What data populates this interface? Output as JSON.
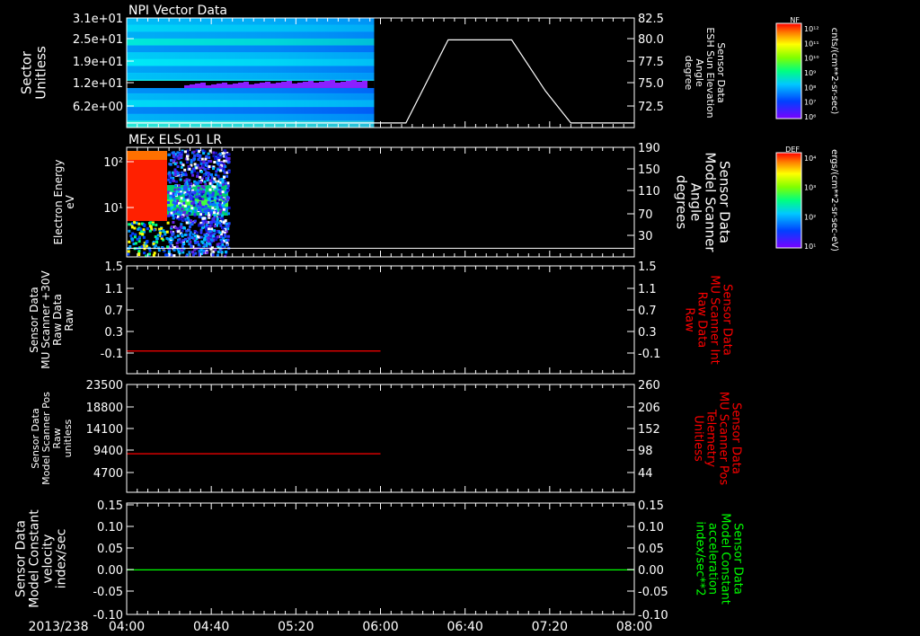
{
  "time_axis": {
    "date_label": "2013/238",
    "ticks": [
      "04:00",
      "04:40",
      "05:20",
      "06:00",
      "06:40",
      "07:20",
      "08:00"
    ]
  },
  "colors": {
    "white": "#ffffff",
    "red": "#ff0000",
    "green": "#00ff00",
    "background": "#000000"
  },
  "panels": [
    {
      "id": "npi",
      "title": "NPI Vector Data",
      "left_label": [
        "Sector",
        "Unitless"
      ],
      "left_ticks": [
        "3.1e+01",
        "2.5e+01",
        "1.9e+01",
        "1.2e+01",
        "6.2e+00"
      ],
      "right_label": [
        "Sensor Data",
        "ESH Sun Elevation",
        "Angle",
        "degree"
      ],
      "right_ticks": [
        "82.5",
        "80.0",
        "77.5",
        "75.0",
        "72.5"
      ],
      "colorbar": {
        "title": "NF",
        "ticks": [
          "10¹²",
          "10¹¹",
          "10¹⁰",
          "10⁹",
          "10⁸",
          "10⁷",
          "10⁶"
        ],
        "unit": "cnts/(cm**2-sr-sec)"
      }
    },
    {
      "id": "els",
      "title": "MEx ELS-01 LR",
      "left_label": [
        "Electron Energy",
        "eV"
      ],
      "left_ticks": [
        "10²",
        "10¹"
      ],
      "right_label": [
        "Sensor Data",
        "Model Scanner",
        "Angle",
        "degrees"
      ],
      "right_ticks": [
        "190",
        "150",
        "110",
        "70",
        "30"
      ],
      "colorbar": {
        "title": "DEF",
        "ticks": [
          "10⁴",
          "10³",
          "10²",
          "10¹"
        ],
        "unit": "ergs/(cm**2-sr-sec-eV)"
      }
    },
    {
      "id": "mu_int",
      "title": "",
      "left_label": [
        "Sensor Data",
        "MU Scanner +30V",
        "Raw Data",
        "Raw"
      ],
      "left_ticks": [
        "1.5",
        "1.1",
        "0.7",
        "0.3",
        "-0.1"
      ],
      "right_label": [
        "Sensor Data",
        "MU Scanner Int",
        "Raw Data",
        "Raw"
      ],
      "right_ticks": [
        "1.5",
        "1.1",
        "0.7",
        "0.3",
        "-0.1"
      ]
    },
    {
      "id": "mu_pos",
      "title": "",
      "left_label": [
        "Sensor Data",
        "Model Scanner Pos",
        "Raw",
        "unitless"
      ],
      "left_ticks": [
        "23500",
        "18800",
        "14100",
        "9400",
        "4700"
      ],
      "right_label": [
        "Sensor Data",
        "MU Scanner Pos",
        "Telemetry",
        "Unitless"
      ],
      "right_ticks": [
        "260",
        "206",
        "152",
        "98",
        "44"
      ]
    },
    {
      "id": "const",
      "title": "",
      "left_label": [
        "Sensor Data",
        "Model Constant",
        "velocity",
        "index/sec"
      ],
      "left_ticks": [
        "0.15",
        "0.10",
        "0.05",
        "0.00",
        "-0.05",
        "-0.10"
      ],
      "right_label": [
        "Sensor Data",
        "Model Constant",
        "acceleration",
        "index/sec**2"
      ],
      "right_ticks": [
        "0.15",
        "0.10",
        "0.05",
        "0.00",
        "-0.05",
        "-0.10"
      ]
    }
  ],
  "chart_data": [
    {
      "type": "heatmap",
      "title": "NPI Vector Data",
      "x": [
        "04:00",
        "05:57"
      ],
      "y_ticks": [
        31,
        25,
        19,
        12,
        6.2
      ],
      "overlay_line": {
        "name": "ESH Sun Elevation Angle",
        "x": [
          "04:00",
          "05:57",
          "06:12",
          "06:32",
          "07:02",
          "07:18",
          "07:30",
          "08:00"
        ],
        "y": [
          71.5,
          71.5,
          71.5,
          80.6,
          80.6,
          75,
          71.5,
          71.5
        ],
        "ylim": [
          71,
          83
        ]
      }
    },
    {
      "type": "heatmap",
      "title": "MEx ELS-01 LR",
      "x": [
        "04:00",
        "04:48"
      ],
      "y_range": [
        2,
        180
      ],
      "overlay_line": {
        "name": "Model Scanner Angle",
        "x": [
          "04:00",
          "08:00"
        ],
        "y": [
          15,
          15
        ],
        "ylim": [
          0,
          190
        ]
      }
    },
    {
      "type": "line",
      "series": [
        {
          "name": "MU Scanner +30V",
          "x": [
            "04:00",
            "06:00"
          ],
          "y": [
            0.0,
            0.0
          ]
        }
      ],
      "ylim": [
        -0.4,
        1.5
      ]
    },
    {
      "type": "line",
      "series": [
        {
          "name": "Model Scanner Pos",
          "x": [
            "04:00",
            "06:00"
          ],
          "y": [
            8400,
            8400
          ]
        }
      ],
      "ylim": [
        0,
        23500
      ]
    },
    {
      "type": "line",
      "series": [
        {
          "name": "Model Constant velocity",
          "x": [
            "04:00",
            "08:00"
          ],
          "y": [
            0.0,
            0.0
          ]
        }
      ],
      "ylim": [
        -0.1,
        0.15
      ]
    }
  ]
}
